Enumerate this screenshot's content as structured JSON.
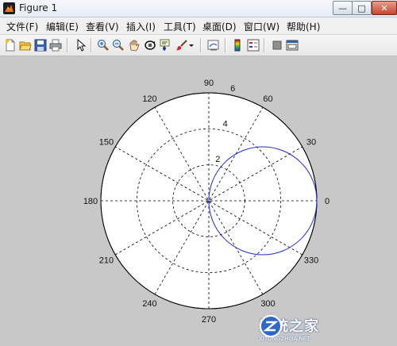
{
  "window": {
    "title": "Figure 1",
    "controls": {
      "minimize": "—",
      "maximize": "□",
      "close": "✕"
    }
  },
  "menu": [
    "文件(F)",
    "编辑(E)",
    "查看(V)",
    "插入(I)",
    "工具(T)",
    "桌面(D)",
    "窗口(W)",
    "帮助(H)"
  ],
  "toolbar": [
    "new-figure-icon",
    "open-file-icon",
    "save-icon",
    "print-icon",
    "pointer-icon",
    "zoom-in-icon",
    "zoom-out-icon",
    "pan-icon",
    "rotate-3d-icon",
    "data-cursor-icon",
    "brush-icon",
    "dropdown-arrow-icon",
    "link-plot-icon",
    "colorbar-icon",
    "legend-icon",
    "hide-plot-tools-icon",
    "show-plot-tools-icon"
  ],
  "chart_data": {
    "type": "polar",
    "angular_ticks": [
      {
        "deg": 0,
        "label": "0"
      },
      {
        "deg": 30,
        "label": "30"
      },
      {
        "deg": 60,
        "label": "60"
      },
      {
        "deg": 90,
        "label": "90"
      },
      {
        "deg": 120,
        "label": "120"
      },
      {
        "deg": 150,
        "label": "150"
      },
      {
        "deg": 180,
        "label": "180"
      },
      {
        "deg": 210,
        "label": "210"
      },
      {
        "deg": 240,
        "label": "240"
      },
      {
        "deg": 270,
        "label": "270"
      },
      {
        "deg": 300,
        "label": "300"
      },
      {
        "deg": 330,
        "label": "330"
      }
    ],
    "radial_ticks": [
      {
        "r": 2,
        "label": "2"
      },
      {
        "r": 4,
        "label": "4"
      },
      {
        "r": 6,
        "label": "6"
      }
    ],
    "rlim": [
      0,
      6
    ],
    "series": [
      {
        "equation": "r = 6*cos(theta)",
        "center_r": 3,
        "radius": 3,
        "color": "#1f2bd6"
      }
    ],
    "grid": true,
    "line_color": "#1f2bd6"
  },
  "watermark": {
    "text": "系统之家",
    "subtext": "XITONGZHIJIA.NET"
  }
}
